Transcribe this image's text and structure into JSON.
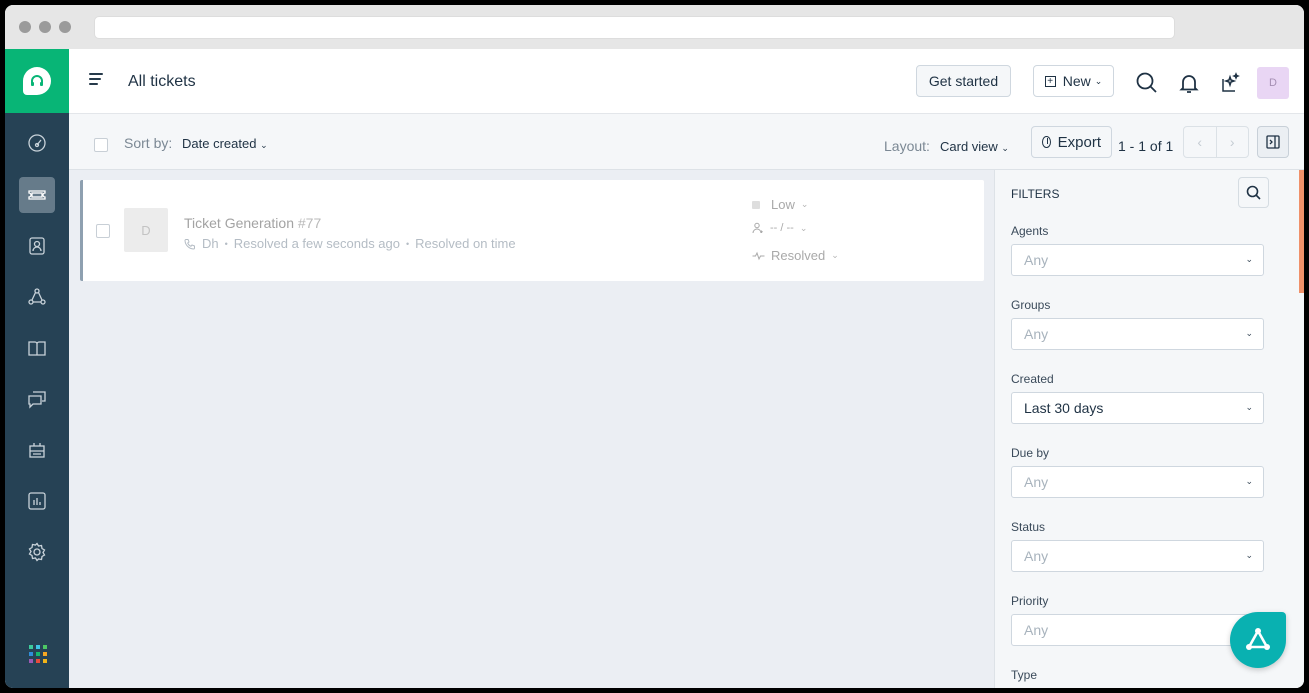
{
  "header": {
    "title": "All tickets",
    "get_started_label": "Get started",
    "new_label": "New",
    "avatar_initial": "D"
  },
  "toolbar": {
    "sort_label": "Sort by:",
    "sort_value": "Date created",
    "layout_label": "Layout:",
    "layout_value": "Card view",
    "export_label": "Export",
    "pagination": "1 - 1 of 1"
  },
  "tickets": [
    {
      "avatar_initial": "D",
      "subject": "Ticket Generation",
      "number": "#77",
      "requester": "Dh",
      "resolved_text": "Resolved a few seconds ago",
      "sla_text": "Resolved on time",
      "priority": "Low",
      "assignee": "-- / --",
      "status": "Resolved"
    }
  ],
  "filters": {
    "title": "FILTERS",
    "fields": [
      {
        "label": "Agents",
        "value": "Any"
      },
      {
        "label": "Groups",
        "value": "Any"
      },
      {
        "label": "Created",
        "value": "Last 30 days"
      },
      {
        "label": "Due by",
        "value": "Any"
      },
      {
        "label": "Status",
        "value": "Any"
      },
      {
        "label": "Priority",
        "value": "Any"
      },
      {
        "label": "Type",
        "value": ""
      }
    ]
  },
  "sidebar": {
    "items": [
      {
        "icon": "dashboard-icon"
      },
      {
        "icon": "tickets-icon",
        "active": true
      },
      {
        "icon": "contacts-icon"
      },
      {
        "icon": "social-icon"
      },
      {
        "icon": "solutions-icon"
      },
      {
        "icon": "discussions-icon"
      },
      {
        "icon": "admin-bot-icon"
      },
      {
        "icon": "reports-icon"
      },
      {
        "icon": "settings-icon"
      }
    ]
  },
  "colors": {
    "brand_green": "#08b576",
    "sidebar_bg": "#264255",
    "fab": "#09b1b1",
    "scroll_accent": "#f0916a"
  }
}
